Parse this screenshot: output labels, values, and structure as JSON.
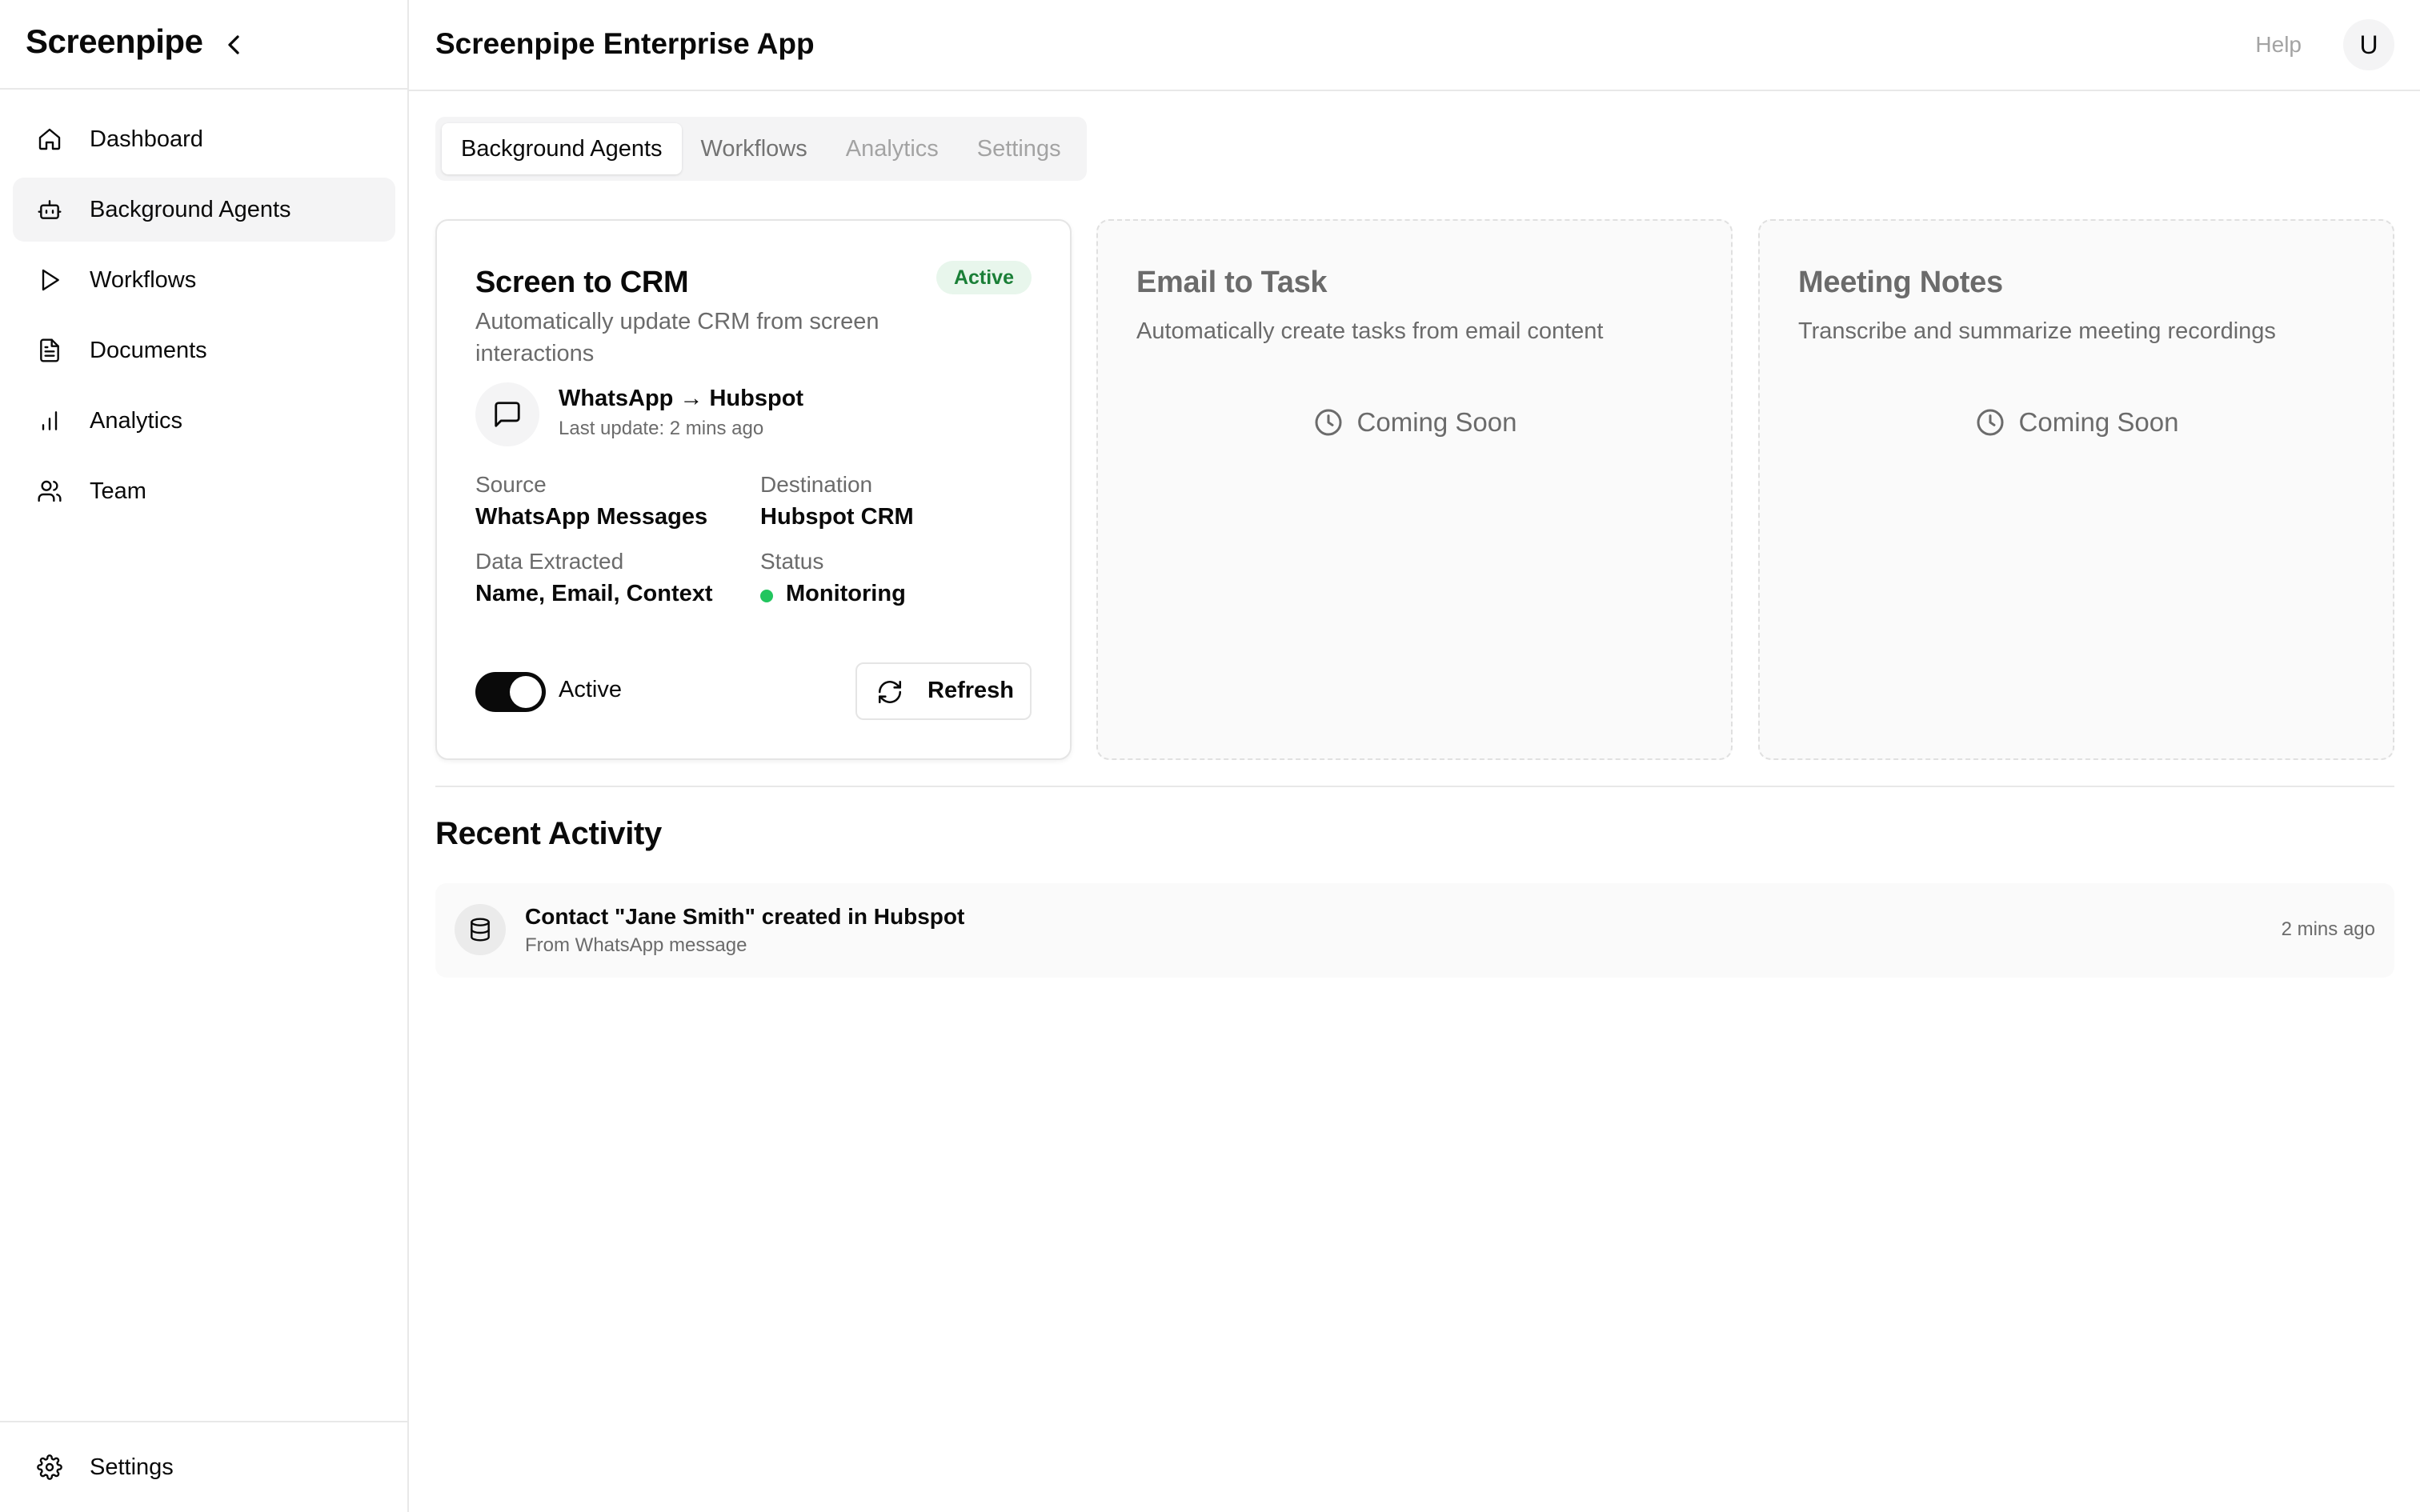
{
  "sidebar": {
    "brand": "Screenpipe",
    "items": [
      {
        "label": "Dashboard",
        "icon": "home-icon"
      },
      {
        "label": "Background Agents",
        "icon": "bot-icon"
      },
      {
        "label": "Workflows",
        "icon": "play-icon"
      },
      {
        "label": "Documents",
        "icon": "document-icon"
      },
      {
        "label": "Analytics",
        "icon": "bar-chart-icon"
      },
      {
        "label": "Team",
        "icon": "users-icon"
      }
    ],
    "active_item": "Background Agents",
    "footer": {
      "label": "Settings",
      "icon": "gear-icon"
    }
  },
  "header": {
    "title": "Screenpipe Enterprise App",
    "help": "Help",
    "avatar": "U"
  },
  "tabs": [
    {
      "label": "Background Agents",
      "state": "active"
    },
    {
      "label": "Workflows",
      "state": "normal"
    },
    {
      "label": "Analytics",
      "state": "muted"
    },
    {
      "label": "Settings",
      "state": "muted"
    }
  ],
  "cards": {
    "crm": {
      "title": "Screen to CRM",
      "badge": "Active",
      "description": "Automatically update CRM from screen interactions",
      "connection": {
        "title": "WhatsApp → Hubspot",
        "subtitle": "Last update: 2 mins ago"
      },
      "source_label": "Source",
      "source_value": "WhatsApp Messages",
      "destination_label": "Destination",
      "destination_value": "Hubspot CRM",
      "extracted_label": "Data Extracted",
      "extracted_value": "Name, Email, Context",
      "status_label": "Status",
      "status_value": "Monitoring",
      "toggle_label": "Active",
      "toggle_on": true,
      "refresh_label": "Refresh"
    },
    "email": {
      "title": "Email to Task",
      "description": "Automatically create tasks from email content",
      "soon": "Coming Soon"
    },
    "meeting": {
      "title": "Meeting Notes",
      "description": "Transcribe and summarize meeting recordings",
      "soon": "Coming Soon"
    }
  },
  "recent_activity": {
    "title": "Recent Activity",
    "items": [
      {
        "title": "Contact \"Jane Smith\" created in Hubspot",
        "subtitle": "From WhatsApp message",
        "time": "2 mins ago",
        "icon": "database-icon"
      }
    ]
  },
  "colors": {
    "accent": "#0a0a0a",
    "status_green": "#22c55e",
    "badge_bg": "#e8f6ec",
    "badge_text": "#1a7f37"
  }
}
